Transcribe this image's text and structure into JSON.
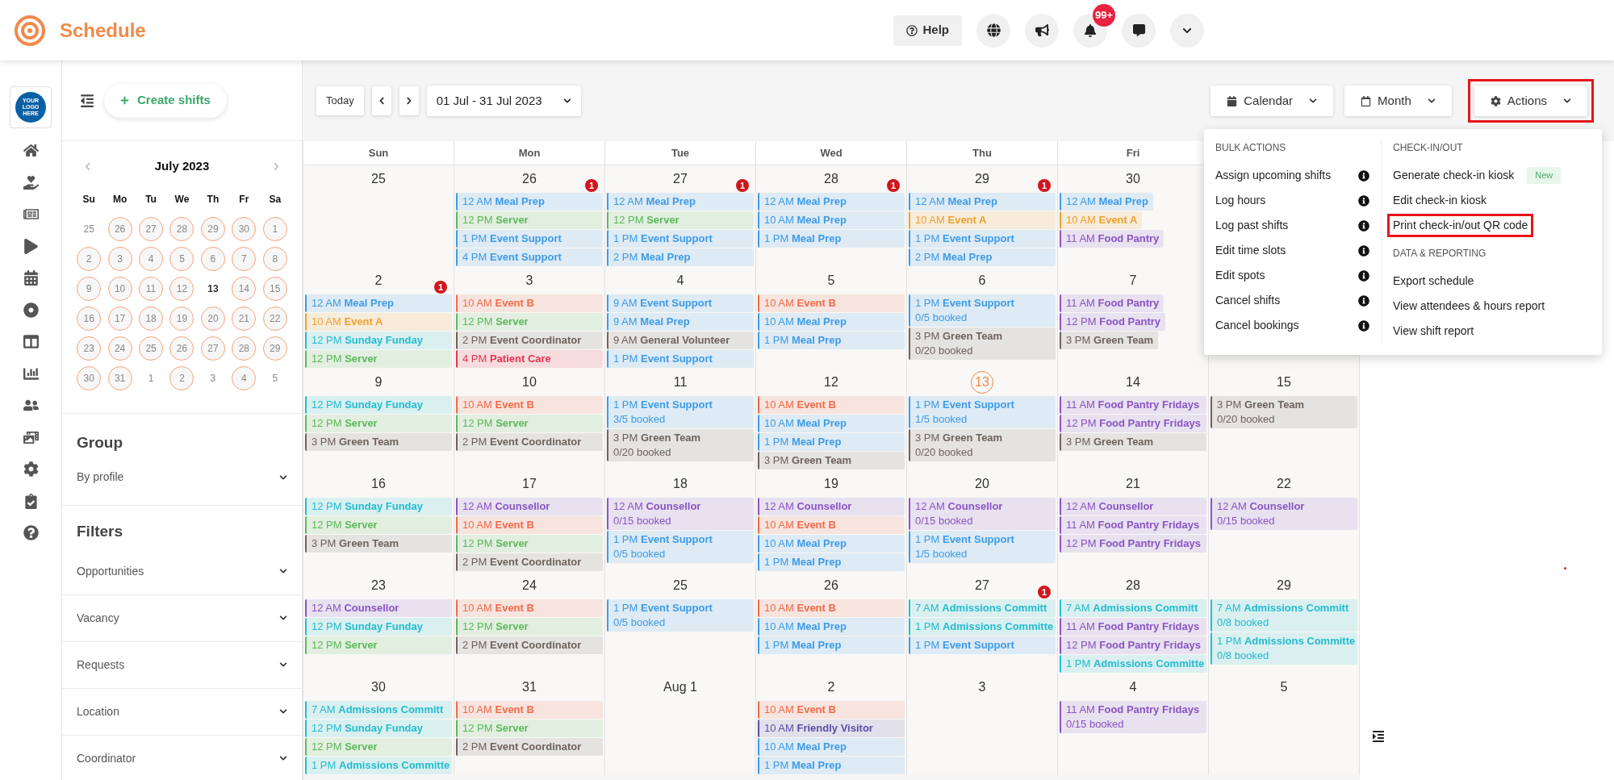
{
  "app": {
    "title": "Schedule",
    "logo_text": "YOUR LOGO HERE"
  },
  "header": {
    "help": "Help",
    "notification_count": "99+"
  },
  "sidebar": {
    "create_button": "Create shifts",
    "mini_calendar": {
      "title": "July 2023",
      "weekdays": [
        "Su",
        "Mo",
        "Tu",
        "We",
        "Th",
        "Fr",
        "Sa"
      ],
      "days": [
        {
          "label": "25",
          "has_shifts": false,
          "today": false
        },
        {
          "label": "26",
          "has_shifts": true,
          "today": false
        },
        {
          "label": "27",
          "has_shifts": true,
          "today": false
        },
        {
          "label": "28",
          "has_shifts": true,
          "today": false
        },
        {
          "label": "29",
          "has_shifts": true,
          "today": false
        },
        {
          "label": "30",
          "has_shifts": true,
          "today": false
        },
        {
          "label": "1",
          "has_shifts": true,
          "today": false
        },
        {
          "label": "2",
          "has_shifts": true,
          "today": false
        },
        {
          "label": "3",
          "has_shifts": true,
          "today": false
        },
        {
          "label": "4",
          "has_shifts": true,
          "today": false
        },
        {
          "label": "5",
          "has_shifts": true,
          "today": false
        },
        {
          "label": "6",
          "has_shifts": true,
          "today": false
        },
        {
          "label": "7",
          "has_shifts": true,
          "today": false
        },
        {
          "label": "8",
          "has_shifts": true,
          "today": false
        },
        {
          "label": "9",
          "has_shifts": true,
          "today": false
        },
        {
          "label": "10",
          "has_shifts": true,
          "today": false
        },
        {
          "label": "11",
          "has_shifts": true,
          "today": false
        },
        {
          "label": "12",
          "has_shifts": true,
          "today": false
        },
        {
          "label": "13",
          "has_shifts": false,
          "today": true
        },
        {
          "label": "14",
          "has_shifts": true,
          "today": false
        },
        {
          "label": "15",
          "has_shifts": true,
          "today": false
        },
        {
          "label": "16",
          "has_shifts": true,
          "today": false
        },
        {
          "label": "17",
          "has_shifts": true,
          "today": false
        },
        {
          "label": "18",
          "has_shifts": true,
          "today": false
        },
        {
          "label": "19",
          "has_shifts": true,
          "today": false
        },
        {
          "label": "20",
          "has_shifts": true,
          "today": false
        },
        {
          "label": "21",
          "has_shifts": true,
          "today": false
        },
        {
          "label": "22",
          "has_shifts": true,
          "today": false
        },
        {
          "label": "23",
          "has_shifts": true,
          "today": false
        },
        {
          "label": "24",
          "has_shifts": true,
          "today": false
        },
        {
          "label": "25",
          "has_shifts": true,
          "today": false
        },
        {
          "label": "26",
          "has_shifts": true,
          "today": false
        },
        {
          "label": "27",
          "has_shifts": true,
          "today": false
        },
        {
          "label": "28",
          "has_shifts": true,
          "today": false
        },
        {
          "label": "29",
          "has_shifts": true,
          "today": false
        },
        {
          "label": "30",
          "has_shifts": true,
          "today": false
        },
        {
          "label": "31",
          "has_shifts": true,
          "today": false
        },
        {
          "label": "1",
          "has_shifts": false,
          "today": false
        },
        {
          "label": "2",
          "has_shifts": true,
          "today": false
        },
        {
          "label": "3",
          "has_shifts": false,
          "today": false
        },
        {
          "label": "4",
          "has_shifts": true,
          "today": false
        },
        {
          "label": "5",
          "has_shifts": false,
          "today": false
        }
      ]
    },
    "group": {
      "heading": "Group",
      "select": "By profile"
    },
    "filters": {
      "heading": "Filters",
      "items": [
        "Opportunities",
        "Vacancy",
        "Requests",
        "Location",
        "Coordinator"
      ]
    }
  },
  "toolbar": {
    "today": "Today",
    "date_range": "01 Jul - 31 Jul 2023",
    "selects": [
      {
        "kind": "calendar",
        "label": "Calendar",
        "highlighted": false
      },
      {
        "kind": "month",
        "label": "Month",
        "highlighted": false
      },
      {
        "kind": "actions",
        "label": "Actions",
        "highlighted": true
      }
    ]
  },
  "actions_menu": {
    "columns": [
      {
        "sections": [
          {
            "heading": "BULK ACTIONS",
            "items": [
              {
                "label": "Assign upcoming shifts",
                "info": true,
                "highlighted": false
              },
              {
                "label": "Log hours",
                "info": true,
                "highlighted": false
              },
              {
                "label": "Log past shifts",
                "info": true,
                "highlighted": false
              },
              {
                "label": "Edit time slots",
                "info": true,
                "highlighted": false
              },
              {
                "label": "Edit spots",
                "info": true,
                "highlighted": false
              },
              {
                "label": "Cancel shifts",
                "info": true,
                "highlighted": false
              },
              {
                "label": "Cancel bookings",
                "info": true,
                "highlighted": false
              }
            ]
          }
        ]
      },
      {
        "sections": [
          {
            "heading": "CHECK-IN/OUT",
            "items": [
              {
                "label": "Generate check-in kiosk",
                "badge": "New",
                "info": false,
                "highlighted": false
              },
              {
                "label": "Edit check-in kiosk",
                "info": false,
                "highlighted": false
              },
              {
                "label": "Print check-in/out QR code",
                "info": false,
                "highlighted": true
              }
            ]
          },
          {
            "heading": "DATA & REPORTING",
            "items": [
              {
                "label": "Export schedule",
                "info": false,
                "highlighted": false
              },
              {
                "label": "View attendees & hours report",
                "info": false,
                "highlighted": false
              },
              {
                "label": "View shift report",
                "info": false,
                "highlighted": false
              }
            ]
          }
        ]
      }
    ]
  },
  "calendar": {
    "weekdays": [
      "Sun",
      "Mon",
      "Tue",
      "Wed",
      "Thu",
      "Fri"
    ],
    "weeks": [
      {
        "days": [
          {
            "date": "25",
            "today": false
          },
          {
            "date": "26",
            "today": false,
            "events": [
              {
                "time": "12 AM",
                "title": "Meal Prep",
                "color": "#3d9be9",
                "badge": "1"
              },
              {
                "time": "12 PM",
                "title": "Server",
                "color": "#5cb85c"
              },
              {
                "time": "1 PM",
                "title": "Event Support",
                "color": "#3d9be9"
              },
              {
                "time": "4 PM",
                "title": "Event Support",
                "color": "#3d9be9"
              }
            ]
          },
          {
            "date": "27",
            "today": false,
            "events": [
              {
                "time": "12 AM",
                "title": "Meal Prep",
                "color": "#3d9be9",
                "badge": "1"
              },
              {
                "time": "12 PM",
                "title": "Server",
                "color": "#5cb85c"
              },
              {
                "time": "1 PM",
                "title": "Event Support",
                "color": "#3d9be9"
              },
              {
                "time": "2 PM",
                "title": "Meal Prep",
                "color": "#3d9be9"
              }
            ]
          },
          {
            "date": "28",
            "today": false,
            "events": [
              {
                "time": "12 AM",
                "title": "Meal Prep",
                "color": "#3d9be9",
                "badge": "1"
              },
              {
                "time": "10 AM",
                "title": "Meal Prep",
                "color": "#3d9be9"
              },
              {
                "time": "1 PM",
                "title": "Meal Prep",
                "color": "#3d9be9"
              }
            ]
          },
          {
            "date": "29",
            "today": false,
            "events": [
              {
                "time": "12 AM",
                "title": "Meal Prep",
                "color": "#3d9be9",
                "badge": "1"
              },
              {
                "time": "10 AM",
                "title": "Event A",
                "color": "#f0a030"
              },
              {
                "time": "1 PM",
                "title": "Event Support",
                "color": "#3d9be9"
              },
              {
                "time": "2 PM",
                "title": "Meal Prep",
                "color": "#3d9be9"
              }
            ]
          },
          {
            "date": "30",
            "today": false,
            "events": [
              {
                "time": "12 AM",
                "title": "Meal Prep",
                "color": "#3d9be9"
              },
              {
                "time": "10 AM",
                "title": "Event A",
                "color": "#f0a030"
              },
              {
                "time": "11 AM",
                "title": "Food Pantry",
                "color": "#8a54c4"
              }
            ]
          }
        ]
      },
      {
        "days": [
          {
            "date": "2",
            "today": false,
            "events": [
              {
                "time": "12 AM",
                "title": "Meal Prep",
                "color": "#3d9be9",
                "badge": "1"
              },
              {
                "time": "10 AM",
                "title": "Event A",
                "color": "#f0a030"
              },
              {
                "time": "12 PM",
                "title": "Sunday Funday",
                "color": "#22bcd0"
              },
              {
                "time": "12 PM",
                "title": "Server",
                "color": "#5cb85c"
              }
            ]
          },
          {
            "date": "3",
            "today": false,
            "events": [
              {
                "time": "10 AM",
                "title": "Event B",
                "color": "#f26b4b"
              },
              {
                "time": "12 PM",
                "title": "Server",
                "color": "#5cb85c"
              },
              {
                "time": "2 PM",
                "title": "Event Coordinator",
                "color": "#6f625b"
              },
              {
                "time": "4 PM",
                "title": "Patient Care",
                "color": "#e83550"
              }
            ]
          },
          {
            "date": "4",
            "today": false,
            "events": [
              {
                "time": "9 AM",
                "title": "Event Support",
                "color": "#3d9be9"
              },
              {
                "time": "9 AM",
                "title": "Meal Prep",
                "color": "#3d9be9"
              },
              {
                "time": "9 AM",
                "title": "General Volunteer",
                "color": "#6f625b"
              },
              {
                "time": "1 PM",
                "title": "Event Support",
                "color": "#3d9be9"
              }
            ]
          },
          {
            "date": "5",
            "today": false,
            "events": [
              {
                "time": "10 AM",
                "title": "Event B",
                "color": "#f26b4b"
              },
              {
                "time": "10 AM",
                "title": "Meal Prep",
                "color": "#3d9be9"
              },
              {
                "time": "1 PM",
                "title": "Meal Prep",
                "color": "#3d9be9"
              }
            ]
          },
          {
            "date": "6",
            "today": false,
            "events": [
              {
                "time": "1 PM",
                "title": "Event Support",
                "color": "#3d9be9",
                "booked": "0/5 booked"
              },
              {
                "time": "3 PM",
                "title": "Green Team",
                "color": "#6f625b",
                "booked": "0/20 booked"
              }
            ]
          },
          {
            "date": "7",
            "today": false,
            "events": [
              {
                "time": "11 AM",
                "title": "Food Pantry",
                "color": "#8a54c4"
              },
              {
                "time": "12 PM",
                "title": "Food Pantry",
                "color": "#8a54c4"
              },
              {
                "time": "3 PM",
                "title": "Green Team",
                "color": "#6f625b"
              }
            ]
          }
        ]
      },
      {
        "days": [
          {
            "date": "9",
            "today": false,
            "events": [
              {
                "time": "12 PM",
                "title": "Sunday Funday",
                "color": "#22bcd0"
              },
              {
                "time": "12 PM",
                "title": "Server",
                "color": "#5cb85c"
              },
              {
                "time": "3 PM",
                "title": "Green Team",
                "color": "#6f625b"
              }
            ]
          },
          {
            "date": "10",
            "today": false,
            "events": [
              {
                "time": "10 AM",
                "title": "Event B",
                "color": "#f26b4b"
              },
              {
                "time": "12 PM",
                "title": "Server",
                "color": "#5cb85c"
              },
              {
                "time": "2 PM",
                "title": "Event Coordinator",
                "color": "#6f625b"
              }
            ]
          },
          {
            "date": "11",
            "today": false,
            "events": [
              {
                "time": "1 PM",
                "title": "Event Support",
                "color": "#3d9be9",
                "booked": "3/5 booked"
              },
              {
                "time": "3 PM",
                "title": "Green Team",
                "color": "#6f625b",
                "booked": "0/20 booked"
              }
            ]
          },
          {
            "date": "12",
            "today": false,
            "events": [
              {
                "time": "10 AM",
                "title": "Event B",
                "color": "#f26b4b"
              },
              {
                "time": "10 AM",
                "title": "Meal Prep",
                "color": "#3d9be9"
              },
              {
                "time": "1 PM",
                "title": "Meal Prep",
                "color": "#3d9be9"
              },
              {
                "time": "3 PM",
                "title": "Green Team",
                "color": "#6f625b"
              }
            ]
          },
          {
            "date": "13",
            "today": true,
            "events": [
              {
                "time": "1 PM",
                "title": "Event Support",
                "color": "#3d9be9",
                "booked": "1/5 booked"
              },
              {
                "time": "3 PM",
                "title": "Green Team",
                "color": "#6f625b",
                "booked": "0/20 booked"
              }
            ]
          },
          {
            "date": "14",
            "today": false,
            "events": [
              {
                "time": "11 AM",
                "title": "Food Pantry Fridays",
                "color": "#8a54c4"
              },
              {
                "time": "12 PM",
                "title": "Food Pantry Fridays",
                "color": "#8a54c4"
              },
              {
                "time": "3 PM",
                "title": "Green Team",
                "color": "#6f625b"
              }
            ]
          },
          {
            "date": "15",
            "today": false,
            "events": [
              {
                "time": "3 PM",
                "title": "Green Team",
                "color": "#6f625b",
                "booked": "0/20 booked"
              }
            ]
          }
        ]
      },
      {
        "days": [
          {
            "date": "16",
            "today": false,
            "events": [
              {
                "time": "12 PM",
                "title": "Sunday Funday",
                "color": "#22bcd0"
              },
              {
                "time": "12 PM",
                "title": "Server",
                "color": "#5cb85c"
              },
              {
                "time": "3 PM",
                "title": "Green Team",
                "color": "#6f625b"
              }
            ]
          },
          {
            "date": "17",
            "today": false,
            "events": [
              {
                "time": "12 AM",
                "title": "Counsellor",
                "color": "#8a54c4"
              },
              {
                "time": "10 AM",
                "title": "Event B",
                "color": "#f26b4b"
              },
              {
                "time": "12 PM",
                "title": "Server",
                "color": "#5cb85c"
              },
              {
                "time": "2 PM",
                "title": "Event Coordinator",
                "color": "#6f625b"
              }
            ]
          },
          {
            "date": "18",
            "today": false,
            "events": [
              {
                "time": "12 AM",
                "title": "Counsellor",
                "color": "#8a54c4",
                "booked": "0/15 booked"
              },
              {
                "time": "1 PM",
                "title": "Event Support",
                "color": "#3d9be9",
                "booked": "0/5 booked"
              }
            ]
          },
          {
            "date": "19",
            "today": false,
            "events": [
              {
                "time": "12 AM",
                "title": "Counsellor",
                "color": "#8a54c4"
              },
              {
                "time": "10 AM",
                "title": "Event B",
                "color": "#f26b4b"
              },
              {
                "time": "10 AM",
                "title": "Meal Prep",
                "color": "#3d9be9"
              },
              {
                "time": "1 PM",
                "title": "Meal Prep",
                "color": "#3d9be9"
              }
            ]
          },
          {
            "date": "20",
            "today": false,
            "events": [
              {
                "time": "12 AM",
                "title": "Counsellor",
                "color": "#8a54c4",
                "booked": "0/15 booked"
              },
              {
                "time": "1 PM",
                "title": "Event Support",
                "color": "#3d9be9",
                "booked": "1/5 booked"
              }
            ]
          },
          {
            "date": "21",
            "today": false,
            "events": [
              {
                "time": "12 AM",
                "title": "Counsellor",
                "color": "#8a54c4"
              },
              {
                "time": "11 AM",
                "title": "Food Pantry Fridays",
                "color": "#8a54c4"
              },
              {
                "time": "12 PM",
                "title": "Food Pantry Fridays",
                "color": "#8a54c4"
              }
            ]
          },
          {
            "date": "22",
            "today": false,
            "events": [
              {
                "time": "12 AM",
                "title": "Counsellor",
                "color": "#8a54c4",
                "booked": "0/15 booked"
              }
            ]
          }
        ]
      },
      {
        "days": [
          {
            "date": "23",
            "today": false,
            "events": [
              {
                "time": "12 AM",
                "title": "Counsellor",
                "color": "#8a54c4"
              },
              {
                "time": "12 PM",
                "title": "Sunday Funday",
                "color": "#22bcd0"
              },
              {
                "time": "12 PM",
                "title": "Server",
                "color": "#5cb85c"
              }
            ]
          },
          {
            "date": "24",
            "today": false,
            "events": [
              {
                "time": "10 AM",
                "title": "Event B",
                "color": "#f26b4b"
              },
              {
                "time": "12 PM",
                "title": "Server",
                "color": "#5cb85c"
              },
              {
                "time": "2 PM",
                "title": "Event Coordinator",
                "color": "#6f625b"
              }
            ]
          },
          {
            "date": "25",
            "today": false,
            "events": [
              {
                "time": "1 PM",
                "title": "Event Support",
                "color": "#3d9be9",
                "booked": "0/5 booked"
              }
            ]
          },
          {
            "date": "26",
            "today": false,
            "events": [
              {
                "time": "10 AM",
                "title": "Event B",
                "color": "#f26b4b"
              },
              {
                "time": "10 AM",
                "title": "Meal Prep",
                "color": "#3d9be9"
              },
              {
                "time": "1 PM",
                "title": "Meal Prep",
                "color": "#3d9be9"
              }
            ]
          },
          {
            "date": "27",
            "today": false,
            "events": [
              {
                "time": "7 AM",
                "title": "Admissions Committ",
                "color": "#22bcd0",
                "badge": "1"
              },
              {
                "time": "1 PM",
                "title": "Admissions Committe",
                "color": "#22bcd0"
              },
              {
                "time": "1 PM",
                "title": "Event Support",
                "color": "#3d9be9"
              }
            ]
          },
          {
            "date": "28",
            "today": false,
            "events": [
              {
                "time": "7 AM",
                "title": "Admissions Committ",
                "color": "#22bcd0"
              },
              {
                "time": "11 AM",
                "title": "Food Pantry Fridays",
                "color": "#8a54c4"
              },
              {
                "time": "12 PM",
                "title": "Food Pantry Fridays",
                "color": "#8a54c4"
              },
              {
                "time": "1 PM",
                "title": "Admissions Committe",
                "color": "#22bcd0"
              }
            ]
          },
          {
            "date": "29",
            "today": false,
            "events": [
              {
                "time": "7 AM",
                "title": "Admissions Committ",
                "color": "#22bcd0",
                "booked": "0/8 booked"
              },
              {
                "time": "1 PM",
                "title": "Admissions Committe",
                "color": "#22bcd0",
                "booked": "0/8 booked"
              }
            ]
          }
        ]
      },
      {
        "days": [
          {
            "date": "30",
            "today": false,
            "events": [
              {
                "time": "7 AM",
                "title": "Admissions Committ",
                "color": "#22bcd0"
              },
              {
                "time": "12 PM",
                "title": "Sunday Funday",
                "color": "#22bcd0"
              },
              {
                "time": "12 PM",
                "title": "Server",
                "color": "#5cb85c"
              },
              {
                "time": "1 PM",
                "title": "Admissions Committe",
                "color": "#22bcd0"
              }
            ]
          },
          {
            "date": "31",
            "today": false,
            "events": [
              {
                "time": "10 AM",
                "title": "Event B",
                "color": "#f26b4b"
              },
              {
                "time": "12 PM",
                "title": "Server",
                "color": "#5cb85c"
              },
              {
                "time": "2 PM",
                "title": "Event Coordinator",
                "color": "#6f625b"
              }
            ]
          },
          {
            "date": "Aug 1",
            "today": false
          },
          {
            "date": "2",
            "today": false,
            "events": [
              {
                "time": "10 AM",
                "title": "Event B",
                "color": "#f26b4b"
              },
              {
                "time": "10 AM",
                "title": "Friendly Visitor",
                "color": "#5a4ea8"
              },
              {
                "time": "10 AM",
                "title": "Meal Prep",
                "color": "#3d9be9"
              },
              {
                "time": "1 PM",
                "title": "Meal Prep",
                "color": "#3d9be9"
              }
            ]
          },
          {
            "date": "3",
            "today": false
          },
          {
            "date": "4",
            "today": false,
            "events": [
              {
                "time": "11 AM",
                "title": "Food Pantry Fridays",
                "color": "#8a54c4",
                "booked": "0/15 booked"
              }
            ]
          },
          {
            "date": "5",
            "today": false
          }
        ]
      }
    ]
  }
}
